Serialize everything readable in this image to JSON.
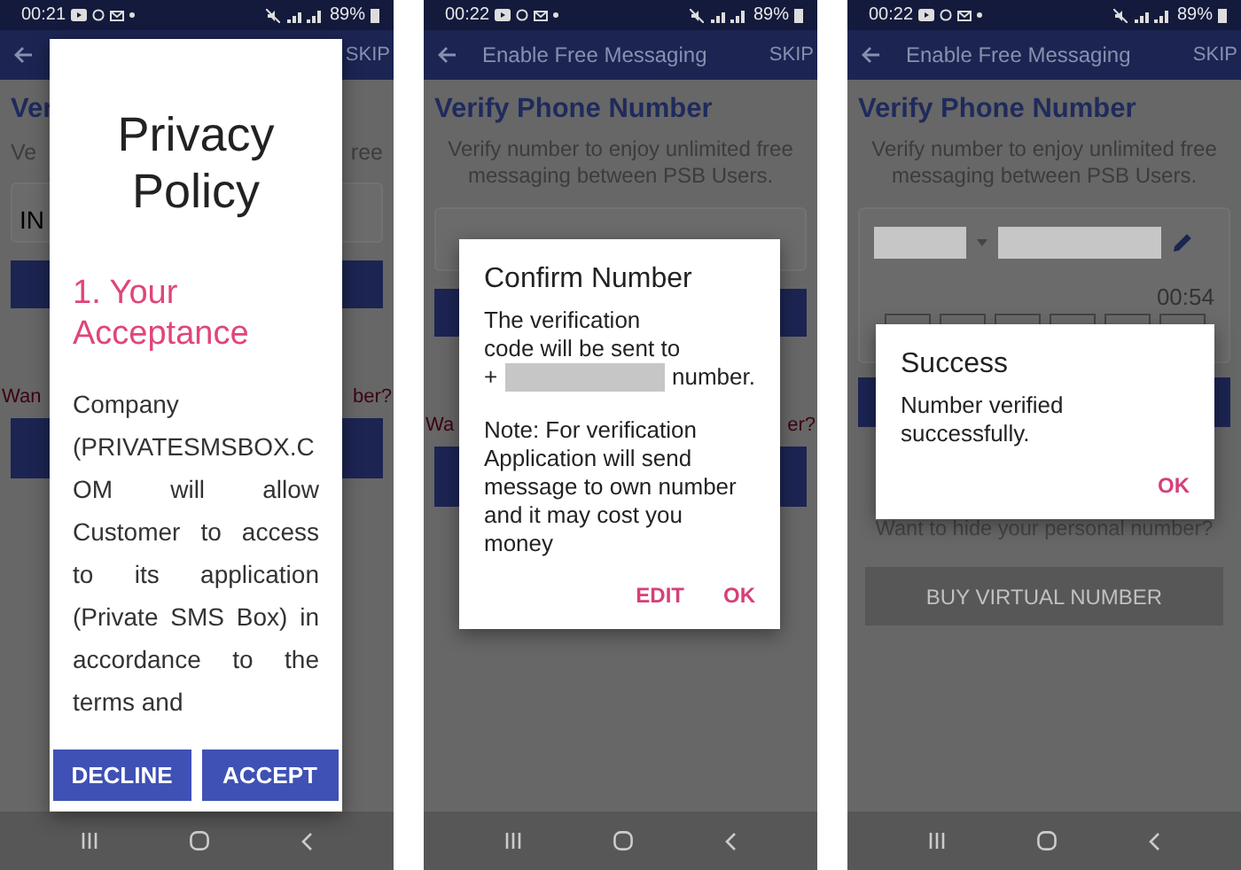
{
  "phones": [
    {
      "kind": "privacy",
      "status_bar": {
        "time": "00:21",
        "battery": "89%"
      },
      "app_bar": {
        "action": "SKIP"
      },
      "screen": {
        "heading": "Ver",
        "subtitle_left": "Ve",
        "subtitle_right": "ree",
        "field": "IN",
        "link_left": "Wan",
        "link_right": "ber?"
      },
      "dialog": {
        "title": "Privacy Policy",
        "section": "1. Your Acceptance",
        "body": "Company (PRIVATESMSBOX.COM will allow Customer to access to its application (Private SMS Box) in accordance to the terms and",
        "buttons": [
          "DECLINE",
          "ACCEPT"
        ]
      }
    },
    {
      "kind": "confirm",
      "status_bar": {
        "time": "00:22",
        "battery": "89%"
      },
      "app_bar": {
        "title": "Enable Free Messaging",
        "action": "SKIP"
      },
      "screen": {
        "heading": "Verify Phone Number",
        "subtitle": "Verify number to enjoy unlimited free messaging between PSB Users.",
        "link_left": "Wa",
        "link_right": "er?"
      },
      "dialog": {
        "title": "Confirm Number",
        "lines": [
          "The verification",
          "code will be sent to"
        ],
        "prefix": "+",
        "suffix": "number.",
        "note": "Note: For verification Application will send message to own number and it may cost you money",
        "buttons": [
          "EDIT",
          "OK"
        ]
      }
    },
    {
      "kind": "success",
      "status_bar": {
        "time": "00:22",
        "battery": "89%"
      },
      "app_bar": {
        "title": "Enable Free Messaging",
        "action": "SKIP"
      },
      "screen": {
        "heading": "Verify Phone Number",
        "subtitle": "Verify number to enjoy unlimited free messaging between PSB Users.",
        "timer": "00:54",
        "link": "Want to hide your personal number?",
        "button": {
          "label": "BUY VIRTUAL NUMBER",
          "disabled": true
        }
      },
      "dialog": {
        "title": "Success",
        "message": "Number verified successfully.",
        "buttons": [
          "OK"
        ]
      }
    }
  ]
}
